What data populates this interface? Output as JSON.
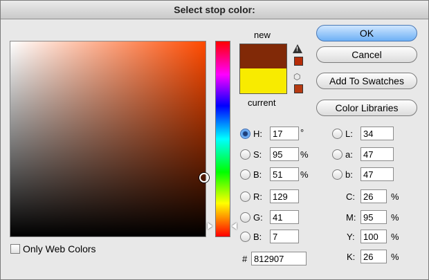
{
  "title": "Select stop color:",
  "swatches": {
    "new_label": "new",
    "current_label": "current",
    "new_color": "#812907",
    "current_color": "#f8eb00"
  },
  "icons": {
    "gamut_warning": "warning-icon",
    "web_safe": "cube-icon"
  },
  "buttons": {
    "ok": "OK",
    "cancel": "Cancel",
    "add_swatches": "Add To Swatches",
    "libraries": "Color Libraries"
  },
  "hsb": {
    "h_label": "H:",
    "h": "17",
    "h_unit": "°",
    "s_label": "S:",
    "s": "95",
    "s_unit": "%",
    "b_label": "B:",
    "b": "51",
    "b_unit": "%"
  },
  "rgb": {
    "r_label": "R:",
    "r": "129",
    "g_label": "G:",
    "g": "41",
    "b_label": "B:",
    "b": "7"
  },
  "lab": {
    "l_label": "L:",
    "l": "34",
    "a_label": "a:",
    "a": "47",
    "b_label": "b:",
    "b": "47"
  },
  "cmyk": {
    "c_label": "C:",
    "c": "26",
    "c_unit": "%",
    "m_label": "M:",
    "m": "95",
    "m_unit": "%",
    "y_label": "Y:",
    "y": "100",
    "y_unit": "%",
    "k_label": "K:",
    "k": "26",
    "k_unit": "%"
  },
  "hex": {
    "label": "#",
    "value": "812907"
  },
  "web_only": {
    "label": "Only Web Colors",
    "checked": false
  },
  "selected_mode": "H"
}
